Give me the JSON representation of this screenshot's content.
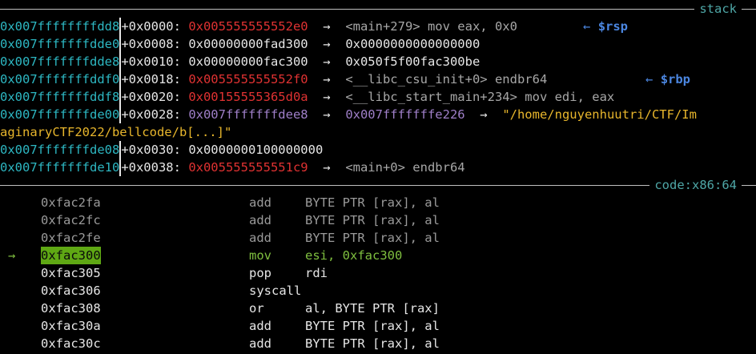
{
  "stack_header": {
    "title": "stack"
  },
  "stack_rows": [
    {
      "addr": "0x007ffffffffdd8",
      "off": "+0x0000:",
      "val": "0x005555555552e0",
      "val_color": "red",
      "arrow": "→",
      "ref": "<main+279> mov eax, 0x0",
      "ref_color": "gray",
      "reg_arrow": "←",
      "reg": "$rsp"
    },
    {
      "addr": "0x007fffffffdde0",
      "off": "+0x0008:",
      "val": "0x00000000fad300",
      "val_color": "white",
      "arrow": "→",
      "ref": "0x0000000000000000",
      "ref_color": "white",
      "reg_arrow": "",
      "reg": ""
    },
    {
      "addr": "0x007fffffffdde8",
      "off": "+0x0010:",
      "val": "0x00000000fac300",
      "val_color": "white",
      "arrow": "→",
      "ref": "0x050f5f00fac300be",
      "ref_color": "white",
      "reg_arrow": "",
      "reg": ""
    },
    {
      "addr": "0x007fffffffddf0",
      "off": "+0x0018:",
      "val": "0x005555555552f0",
      "val_color": "red",
      "arrow": "→",
      "ref": "<__libc_csu_init+0> endbr64",
      "ref_color": "gray",
      "reg_arrow": "←",
      "reg": "$rbp"
    },
    {
      "addr": "0x007fffffffddf8",
      "off": "+0x0020:",
      "val": "0x00155555365d0a",
      "val_color": "red",
      "arrow": "→",
      "ref": "<__libc_start_main+234> mov edi, eax",
      "ref_color": "gray",
      "reg_arrow": "",
      "reg": ""
    },
    {
      "addr": "0x007fffffffde00",
      "off": "+0x0028:",
      "val": "0x007fffffffdee8",
      "val_color": "purple",
      "arrow": "→",
      "ref": "0x007fffffffe226",
      "ref_color": "purple",
      "ref2_arrow": "→",
      "ref2": "\"/home/nguyenhuutri/CTF/Im",
      "ref2_cont": "aginaryCTF2022/bellcode/b[...]\"",
      "reg_arrow": "",
      "reg": ""
    },
    {
      "addr": "0x007fffffffde08",
      "off": "+0x0030:",
      "val": "0x0000000100000000",
      "val_color": "white",
      "arrow": "",
      "ref": "",
      "ref_color": "white",
      "reg_arrow": "",
      "reg": ""
    },
    {
      "addr": "0x007fffffffde10",
      "off": "+0x0038:",
      "val": "0x005555555551c9",
      "val_color": "red",
      "arrow": "→",
      "ref": "<main+0> endbr64",
      "ref_color": "gray",
      "reg_arrow": "",
      "reg": ""
    }
  ],
  "code_header": {
    "title": "code:x86:64"
  },
  "code_rows": [
    {
      "marker": "",
      "addr": "0xfac2fa",
      "mnemonic": "add",
      "operands": "BYTE PTR [rax], al",
      "state": "past"
    },
    {
      "marker": "",
      "addr": "0xfac2fc",
      "mnemonic": "add",
      "operands": "BYTE PTR [rax], al",
      "state": "past"
    },
    {
      "marker": "",
      "addr": "0xfac2fe",
      "mnemonic": "add",
      "operands": "BYTE PTR [rax], al",
      "state": "past"
    },
    {
      "marker": "→",
      "addr": "0xfac300",
      "mnemonic": "mov",
      "operands": "esi, 0xfac300",
      "state": "current"
    },
    {
      "marker": "",
      "addr": "0xfac305",
      "mnemonic": "pop",
      "operands": "rdi",
      "state": "next"
    },
    {
      "marker": "",
      "addr": "0xfac306",
      "mnemonic": "syscall",
      "operands": "",
      "state": "next"
    },
    {
      "marker": "",
      "addr": "0xfac308",
      "mnemonic": "or",
      "operands": "al, BYTE PTR [rax]",
      "state": "next"
    },
    {
      "marker": "",
      "addr": "0xfac30a",
      "mnemonic": "add",
      "operands": "BYTE PTR [rax], al",
      "state": "next"
    },
    {
      "marker": "",
      "addr": "0xfac30c",
      "mnemonic": "add",
      "operands": "BYTE PTR [rax], al",
      "state": "next"
    }
  ]
}
